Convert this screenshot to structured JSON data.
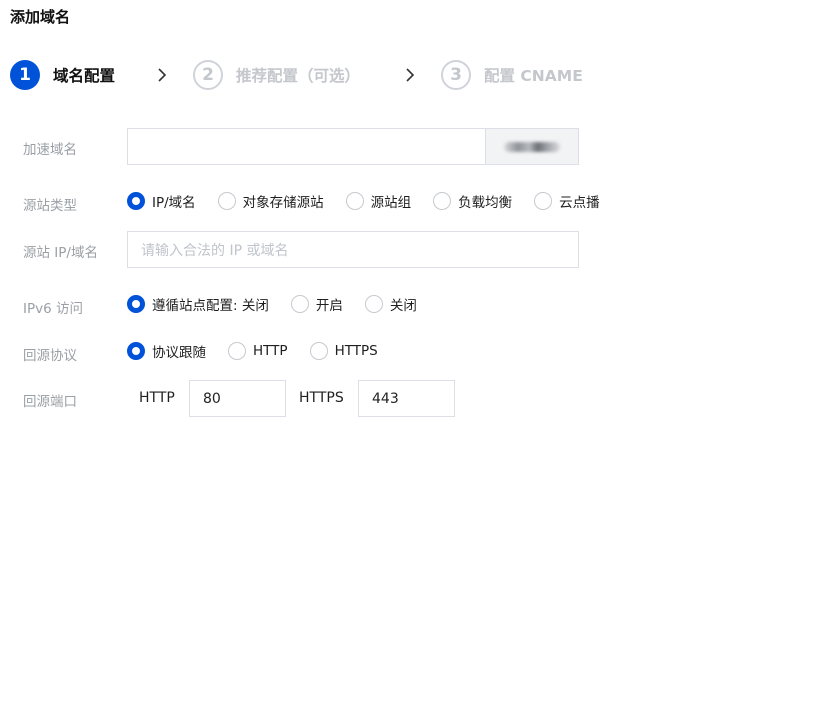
{
  "page": {
    "title": "添加域名"
  },
  "steps": [
    {
      "number": "1",
      "label": "域名配置",
      "state": "active"
    },
    {
      "number": "2",
      "label": "推荐配置（可选）",
      "state": "inactive"
    },
    {
      "number": "3",
      "label": "配置 CNAME",
      "state": "inactive"
    }
  ],
  "form": {
    "domain": {
      "label": "加速域名",
      "value": "",
      "suffix_text": "(blurred)"
    },
    "origin_type": {
      "label": "源站类型",
      "options": [
        "IP/域名",
        "对象存储源站",
        "源站组",
        "负载均衡",
        "云点播"
      ],
      "selected": "IP/域名"
    },
    "origin_address": {
      "label": "源站 IP/域名",
      "placeholder": "请输入合法的 IP 或域名",
      "value": ""
    },
    "ipv6": {
      "label": "IPv6 访问",
      "options": [
        "遵循站点配置: 关闭",
        "开启",
        "关闭"
      ],
      "selected": "遵循站点配置: 关闭"
    },
    "origin_protocol": {
      "label": "回源协议",
      "options": [
        "协议跟随",
        "HTTP",
        "HTTPS"
      ],
      "selected": "协议跟随"
    },
    "origin_port": {
      "label": "回源端口",
      "http_label": "HTTP",
      "http_value": "80",
      "https_label": "HTTPS",
      "https_value": "443"
    }
  },
  "colors": {
    "primary": "#0052d9",
    "muted_label": "#9aa0a6",
    "inactive_step": "#c4c7cc",
    "border": "#dcdfe6"
  }
}
